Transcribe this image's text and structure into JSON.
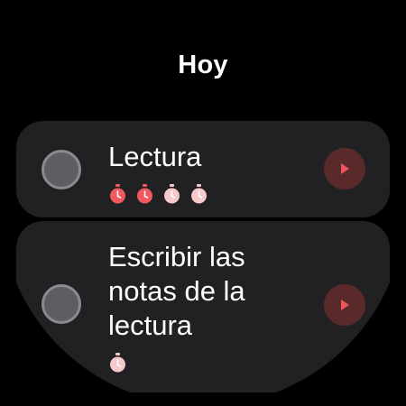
{
  "header": {
    "title": "Hoy"
  },
  "colors": {
    "background": "#000000",
    "card": "#212124",
    "tomato_done": "#f05a5f",
    "tomato_pending": "#f6c9ca",
    "play_bg": "#5a2a2b",
    "play_icon": "#f0555a"
  },
  "tasks": [
    {
      "title": "Lectura",
      "pomodoros": [
        "done",
        "done",
        "pending",
        "pending"
      ],
      "action_icon": "play-icon"
    },
    {
      "title": "Escribir las notas de la lectura",
      "pomodoros": [
        "pending"
      ],
      "action_icon": "play-icon"
    }
  ]
}
